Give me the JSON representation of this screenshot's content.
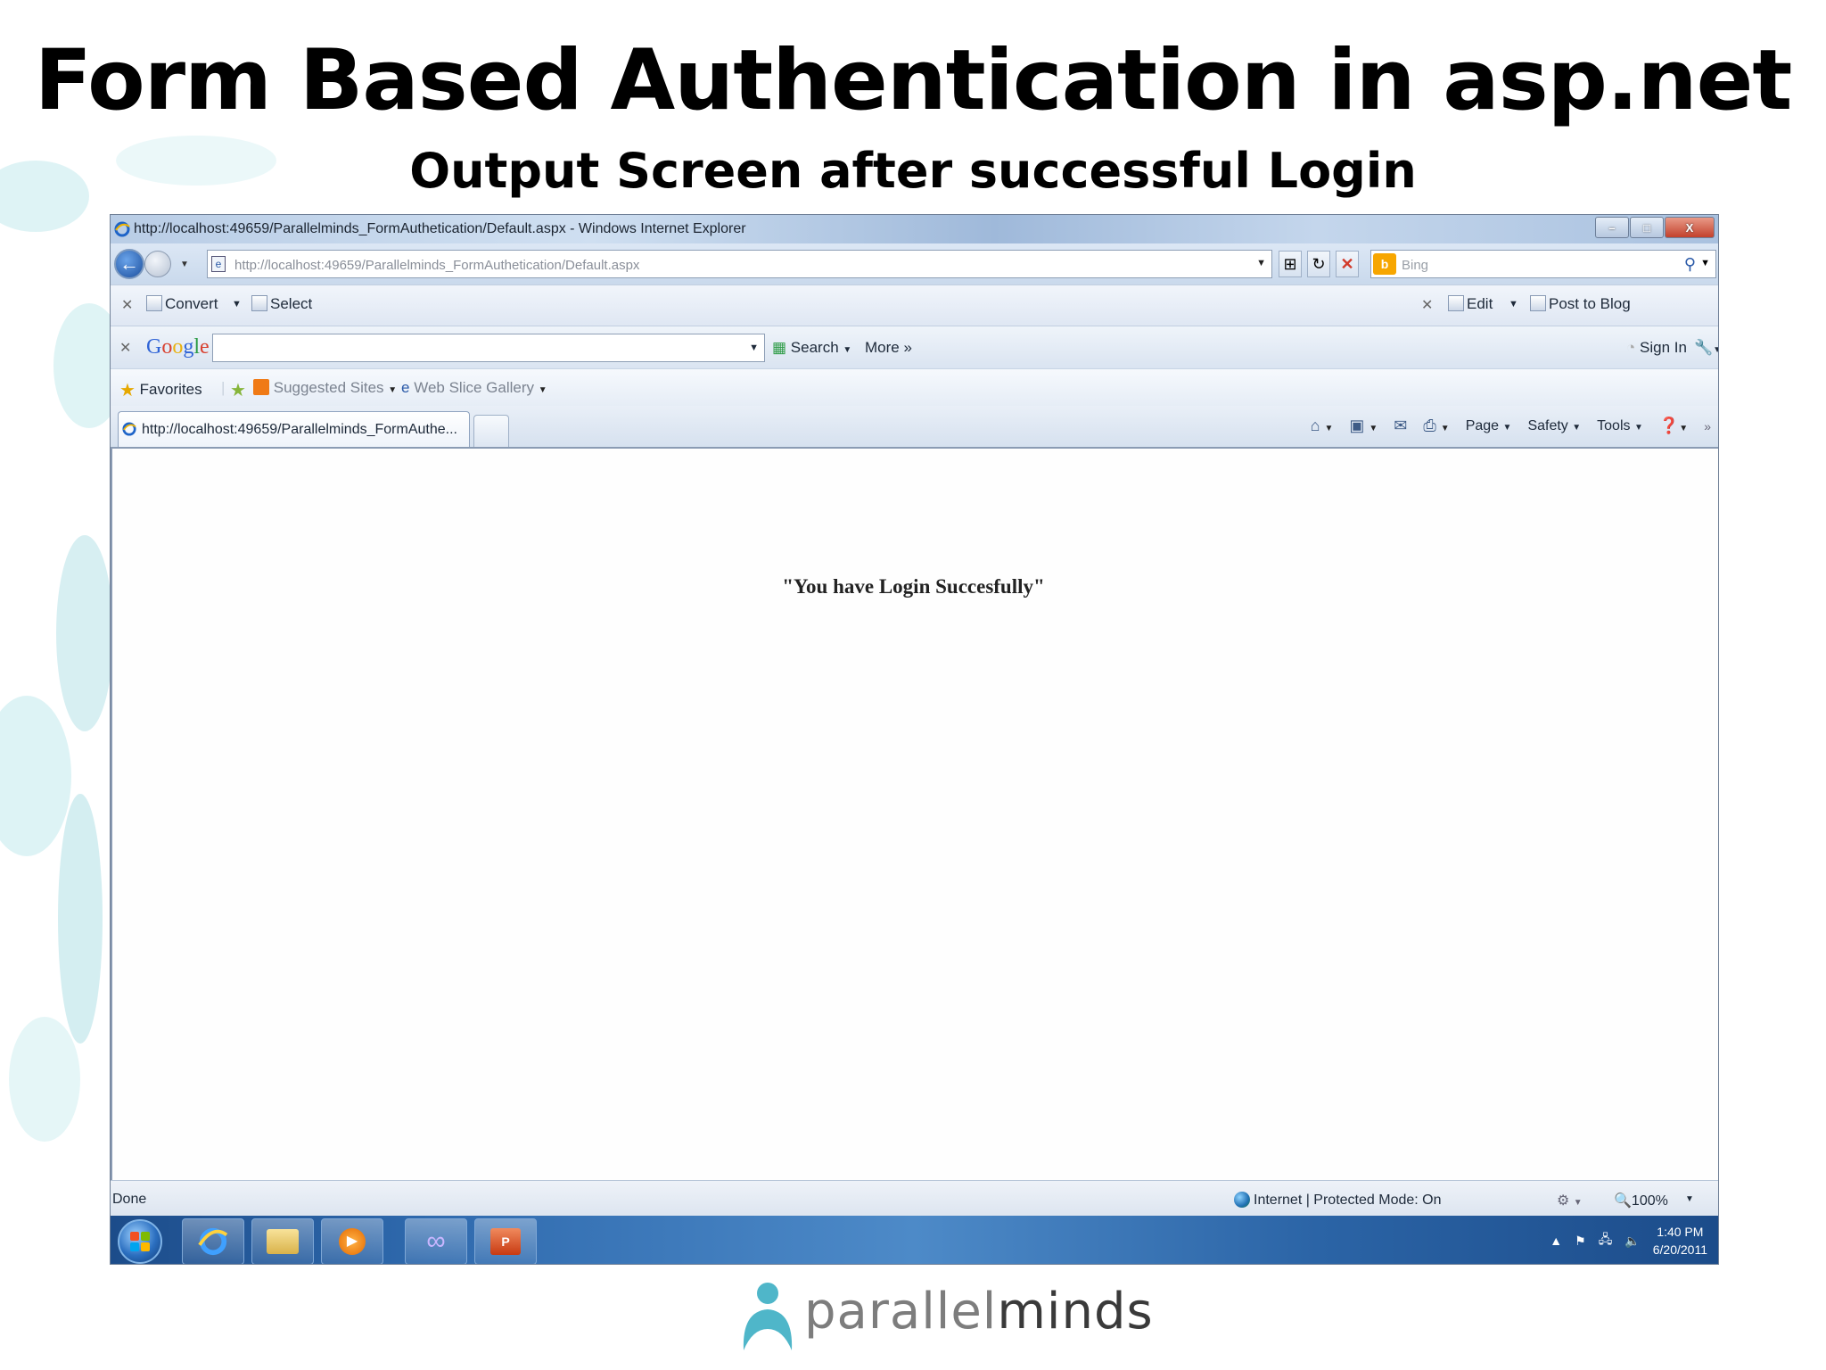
{
  "slide": {
    "title": "Form Based Authentication in asp.net",
    "subtitle": "Output Screen after successful Login"
  },
  "browser": {
    "window_title": "http://localhost:49659/Parallelminds_FormAuthetication/Default.aspx - Windows Internet Explorer",
    "window_buttons": {
      "minimize": "–",
      "maximize": "□",
      "close": "X"
    },
    "address": {
      "url": "http://localhost:49659/Parallelminds_FormAuthetication/Default.aspx",
      "search_placeholder": "Bing"
    },
    "command_bar": {
      "convert_label": "Convert",
      "select_label": "Select",
      "edit_label": "Edit",
      "post_to_blog_label": "Post to Blog"
    },
    "google_bar": {
      "logo": {
        "g1": "G",
        "o1": "o",
        "o2": "o",
        "g2": "g",
        "l": "l",
        "e": "e"
      },
      "search_label": "Search",
      "more_label": "More »",
      "sign_in_label": "Sign In"
    },
    "favorites_bar": {
      "favorites_label": "Favorites",
      "suggested_sites_label": "Suggested Sites",
      "web_slice_gallery_label": "Web Slice Gallery"
    },
    "tab": {
      "label": "http://localhost:49659/Parallelminds_FormAuthe..."
    },
    "commands": {
      "page_label": "Page",
      "safety_label": "Safety",
      "tools_label": "Tools"
    },
    "page_content": {
      "message": "\"You have Login Succesfully\""
    },
    "status": {
      "left_text": "Done",
      "zone_text": "Internet | Protected Mode: On",
      "zoom": "100%"
    }
  },
  "taskbar": {
    "time": "1:40 PM",
    "date": "6/20/2011",
    "apps": [
      "internet-explorer",
      "windows-explorer",
      "media-player",
      "visual-studio",
      "powerpoint"
    ]
  },
  "footer": {
    "brand_light": "parallel",
    "brand_dark": "minds"
  },
  "colors": {
    "accent": "#2b5aa8",
    "taskbar": "#2f6aae",
    "brand_teal": "#4fb6c9"
  }
}
